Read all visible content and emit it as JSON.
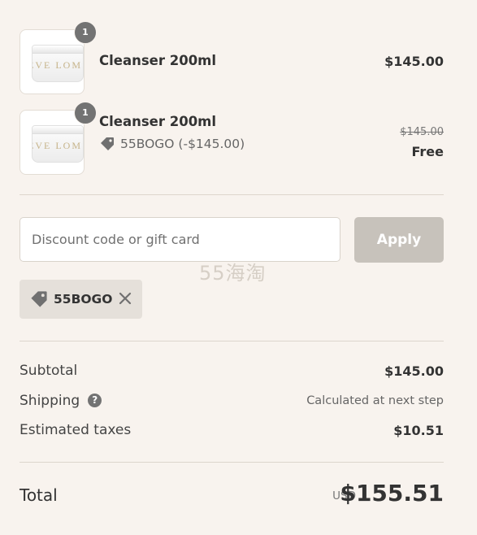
{
  "line_items": [
    {
      "name": "Cleanser 200ml",
      "quantity": "1",
      "brand_mark": "EVE LOM",
      "price": "$145.00"
    },
    {
      "name": "Cleanser 200ml",
      "quantity": "1",
      "brand_mark": "EVE LOM",
      "original_price": "$145.00",
      "price": "Free",
      "discount_text": "55BOGO (-$145.00)"
    }
  ],
  "discount": {
    "placeholder": "Discount code or gift card",
    "apply_label": "Apply",
    "applied_code": "55BOGO"
  },
  "watermark": "55海淘",
  "summary": {
    "subtotal_label": "Subtotal",
    "subtotal_value": "$145.00",
    "shipping_label": "Shipping",
    "shipping_help": "?",
    "shipping_value": "Calculated at next step",
    "taxes_label": "Estimated taxes",
    "taxes_value": "$10.51",
    "total_label": "Total",
    "currency": "USD",
    "total_value": "$155.51"
  },
  "colors": {
    "background": "#f8f3ee",
    "badge": "#737373",
    "apply_button": "#c7c2bb",
    "chip": "#e5e0da"
  },
  "icons": [
    "tag-icon",
    "close-icon",
    "help-icon"
  ]
}
